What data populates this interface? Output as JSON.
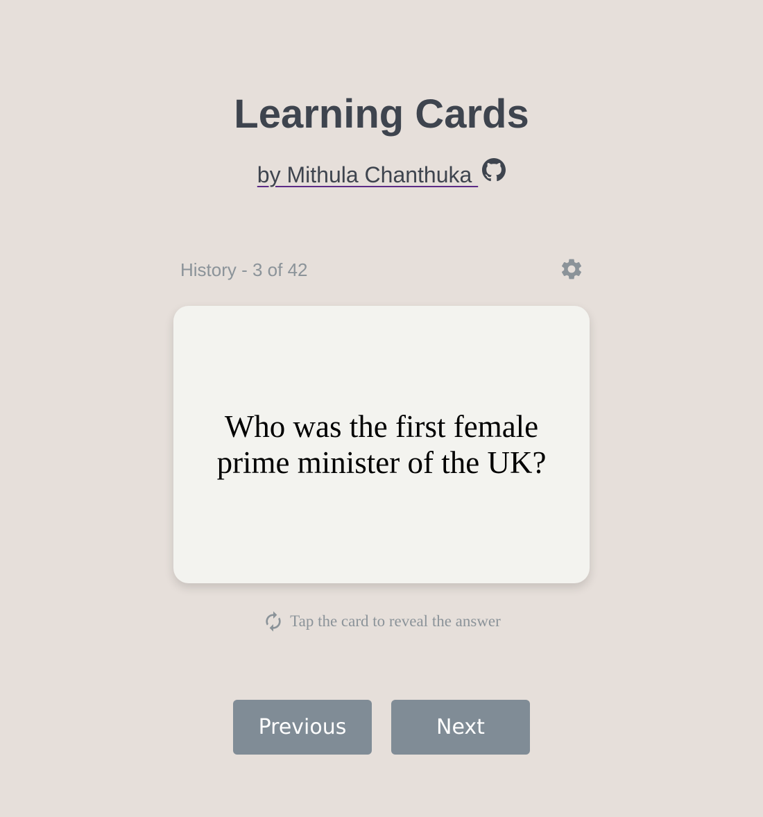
{
  "header": {
    "title": "Learning Cards",
    "author_link": "by Mithula Chanthuka ",
    "github_icon": "github-icon"
  },
  "deck": {
    "label": "History - 3 of 42",
    "settings_icon": "gear-icon"
  },
  "card": {
    "question": "Who was the first female prime minister of the UK?"
  },
  "hint": {
    "icon": "refresh-icon",
    "text": "Tap the card to reveal the answer"
  },
  "navigation": {
    "previous_label": "Previous",
    "next_label": "Next"
  },
  "colors": {
    "background": "#e6dfda",
    "card": "#f3f3ef",
    "button": "#808c96",
    "muted_text": "#8b9399",
    "heading_text": "#3e444e",
    "link_underline": "#5b2a86"
  }
}
